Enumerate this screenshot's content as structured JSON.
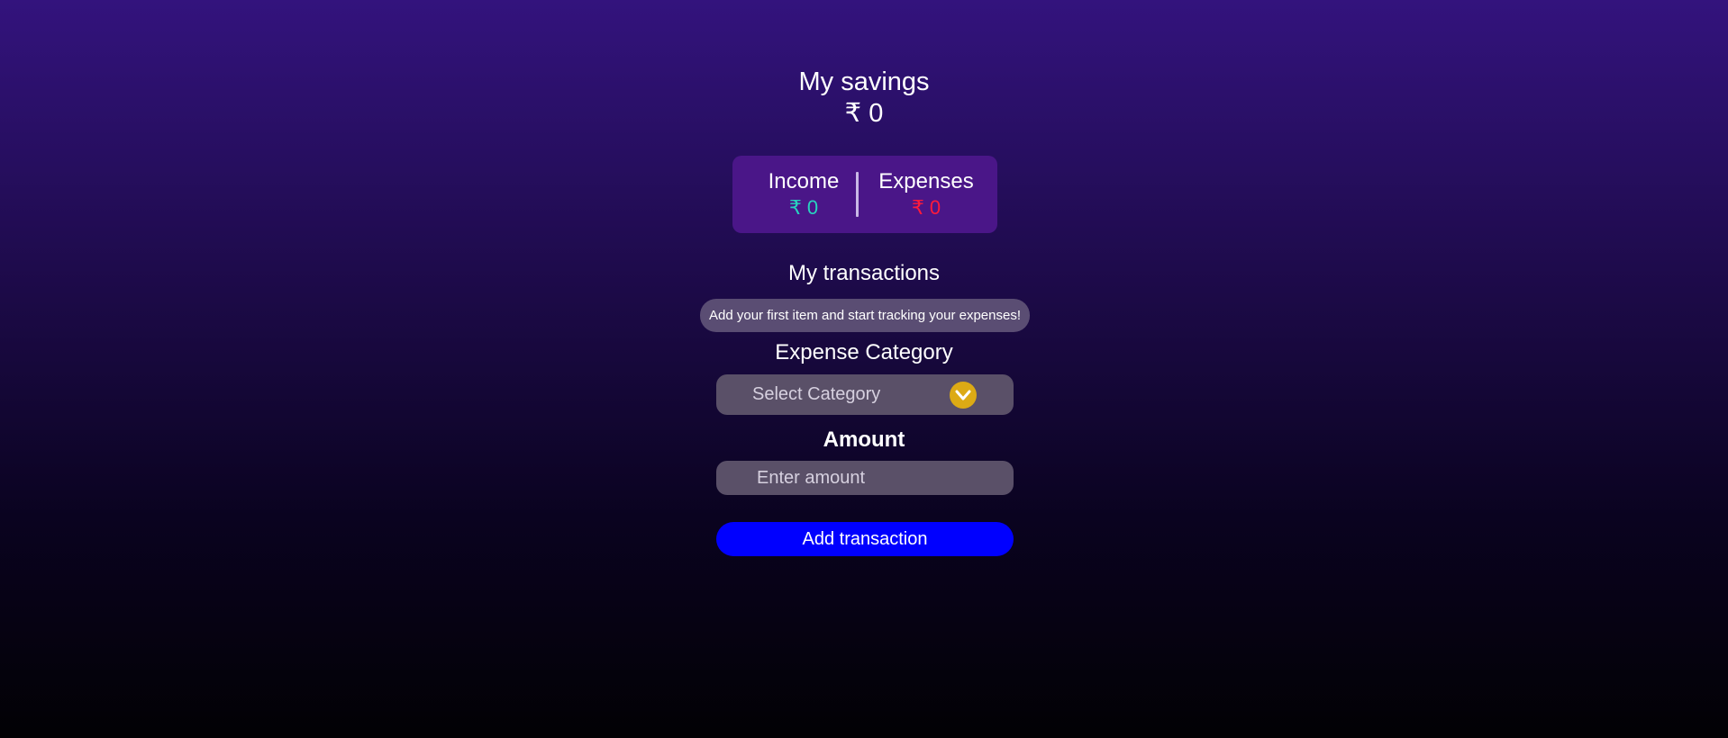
{
  "savings": {
    "title": "My savings",
    "amount": "₹ 0"
  },
  "summary": {
    "income_label": "Income",
    "income_value": "₹ 0",
    "expenses_label": "Expenses",
    "expenses_value": "₹ 0"
  },
  "transactions": {
    "title": "My transactions",
    "empty_message": "Add your first item and start tracking your expenses!"
  },
  "form": {
    "category_label": "Expense Category",
    "category_selected": "Select Category",
    "category_icon": "chevron-down-icon",
    "amount_label": "Amount",
    "amount_placeholder": "Enter amount",
    "amount_value": "",
    "submit_label": "Add transaction"
  },
  "colors": {
    "background_top": "#33137d",
    "background_bottom": "#020104",
    "card": "#4a1688",
    "income": "#28d3bf",
    "expenses": "#ff1a3a",
    "chevron_button": "#dcaa15",
    "submit_button": "#0000ff"
  }
}
